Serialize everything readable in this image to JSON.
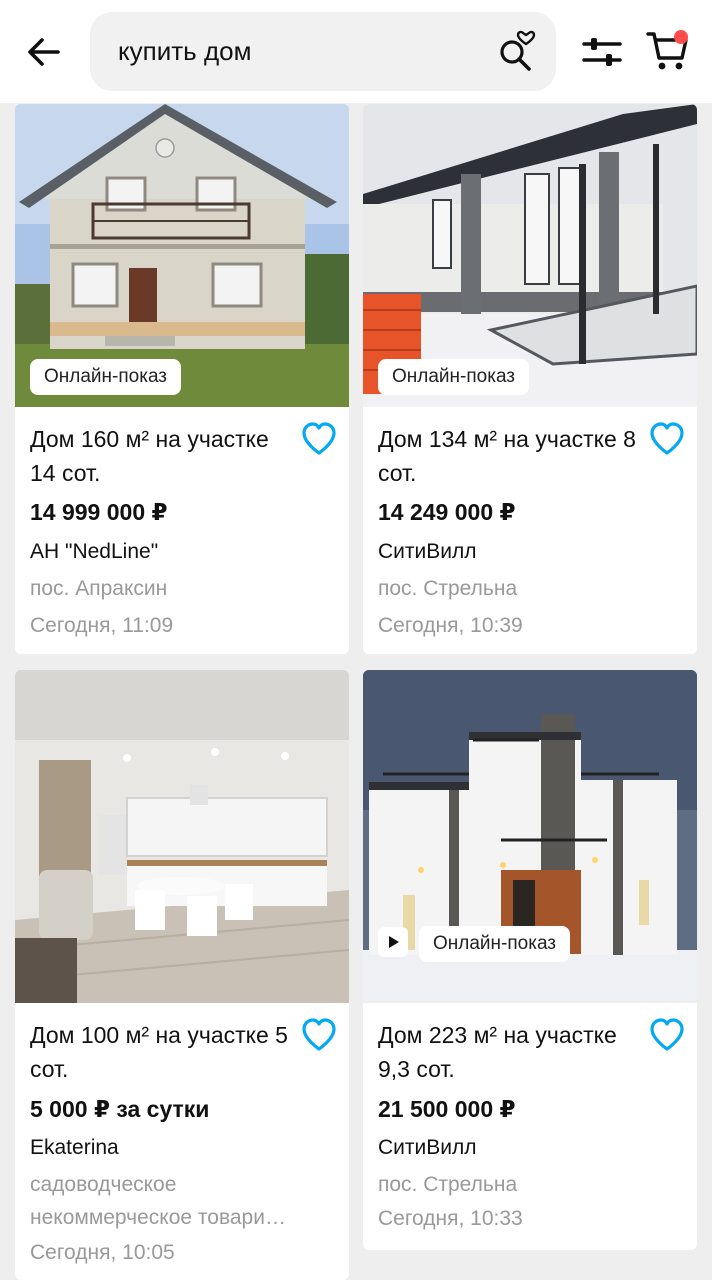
{
  "search": {
    "query": "купить дом"
  },
  "icons": {
    "back": "arrow-left-icon",
    "saved_search": "search-heart-icon",
    "filters": "sliders-icon",
    "cart": "cart-icon",
    "favorite": "heart-outline-icon",
    "play": "play-icon"
  },
  "colors": {
    "accent": "#03a9f4",
    "notification": "#ff4d4d"
  },
  "listings": [
    {
      "badge": "Онлайн-показ",
      "title": "Дом 160 м² на участке 14 сот.",
      "price": "14 999 000 ₽",
      "seller": "АН \"NedLine\"",
      "location": "пос. Апраксин",
      "date": "Сегодня, 11:09"
    },
    {
      "badge": "Онлайн-показ",
      "title": "Дом 134 м² на участке 8 сот.",
      "price": "14 249 000 ₽",
      "seller": "СитиВилл",
      "location": "пос. Стрельна",
      "date": "Сегодня, 10:39"
    },
    {
      "title": "Дом 100 м² на участке 5 сот.",
      "price": "5 000 ₽ за сутки",
      "seller": "Ekaterina",
      "location": "садоводческое некоммерческое товари…",
      "date": "Сегодня, 10:05"
    },
    {
      "badge": "Онлайн-показ",
      "title": "Дом 223 м² на участке 9,3 сот.",
      "price": "21 500 000 ₽",
      "seller": "СитиВилл",
      "location": "пос. Стрельна",
      "date": "Сегодня, 10:33"
    }
  ]
}
